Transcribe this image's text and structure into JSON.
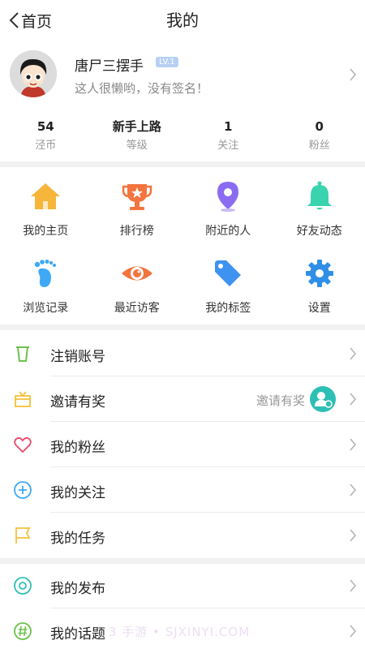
{
  "header": {
    "back_label": "首页",
    "title": "我的"
  },
  "profile": {
    "name": "唐尸三摆手",
    "level": "LV.1",
    "signature": "这人很懒哟，没有签名！"
  },
  "stats": [
    {
      "value": "54",
      "label": "泾币"
    },
    {
      "value": "新手上路",
      "label": "等级"
    },
    {
      "value": "1",
      "label": "关注"
    },
    {
      "value": "0",
      "label": "粉丝"
    }
  ],
  "grid": [
    {
      "label": "我的主页",
      "icon": "home-icon",
      "color": "#f6b53b"
    },
    {
      "label": "排行榜",
      "icon": "trophy-icon",
      "color": "#f2743e"
    },
    {
      "label": "附近的人",
      "icon": "location-pin-icon",
      "color": "#8a6cf1"
    },
    {
      "label": "好友动态",
      "icon": "bell-icon",
      "color": "#3ad3b0"
    },
    {
      "label": "浏览记录",
      "icon": "footprint-icon",
      "color": "#3fa9f5"
    },
    {
      "label": "最近访客",
      "icon": "eye-icon",
      "color": "#f2743e"
    },
    {
      "label": "我的标签",
      "icon": "tag-icon",
      "color": "#3f93f0"
    },
    {
      "label": "设置",
      "icon": "gear-icon",
      "color": "#2f8fe6"
    }
  ],
  "menu1": [
    {
      "label": "注销账号",
      "icon": "trash-icon",
      "color": "#6cc24a"
    },
    {
      "label": "邀请有奖",
      "icon": "gift-icon",
      "color": "#f3c13a",
      "hint": "邀请有奖"
    },
    {
      "label": "我的粉丝",
      "icon": "heart-icon",
      "color": "#e84a6a"
    },
    {
      "label": "我的关注",
      "icon": "plus-circle-icon",
      "color": "#3fa9f5"
    },
    {
      "label": "我的任务",
      "icon": "flag-icon",
      "color": "#f3c13a"
    }
  ],
  "menu2": [
    {
      "label": "我的发布",
      "icon": "target-icon",
      "color": "#2dbfb4"
    },
    {
      "label": "我的话题",
      "icon": "hashtag-icon",
      "color": "#6cc24a"
    }
  ],
  "watermark": "3 手游 • SJXINYI.COM"
}
